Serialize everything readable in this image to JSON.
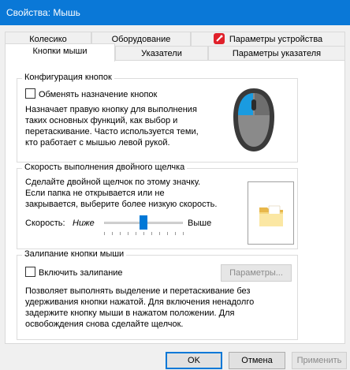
{
  "window": {
    "title": "Свойства: Мышь"
  },
  "tabs_back": [
    {
      "label": "Колесико"
    },
    {
      "label": "Оборудование"
    },
    {
      "label": "Параметры устройства"
    }
  ],
  "tabs_front": [
    {
      "label": "Кнопки мыши",
      "active": true
    },
    {
      "label": "Указатели"
    },
    {
      "label": "Параметры указателя"
    }
  ],
  "button_config": {
    "title": "Конфигурация кнопок",
    "swap_checkbox_label": "Обменять назначение кнопок",
    "swap_checked": false,
    "description": [
      "Назначает правую кнопку для выполнения",
      "таких основных функций, как выбор и",
      "перетаскивание. Часто используется теми,",
      "кто работает с мышью левой рукой."
    ]
  },
  "double_click": {
    "title": "Скорость выполнения двойного щелчка",
    "description": [
      "Сделайте двойной щелчок по этому значку.",
      "Если папка не открывается или не",
      "закрывается, выберите более низкую скорость."
    ],
    "speed_label": "Скорость:",
    "slow_label": "Ниже",
    "fast_label": "Выше",
    "speed_level_fraction": 0.5
  },
  "click_lock": {
    "title": "Залипание кнопки мыши",
    "checkbox_label": "Включить залипание",
    "checked": false,
    "settings_button": "Параметры...",
    "description": [
      "Позволяет выполнять выделение и перетаскивание без",
      "удерживания кнопки нажатой. Для включения ненадолго",
      "задержите кнопку мыши в нажатом положении. Для",
      "освобождения снова сделайте щелчок."
    ]
  },
  "footer": {
    "ok": "OK",
    "cancel": "Отмена",
    "apply": "Применить"
  },
  "colors": {
    "titlebar": "#0a78d7",
    "accent": "#0078d7",
    "device_icon": "#e0202a"
  }
}
